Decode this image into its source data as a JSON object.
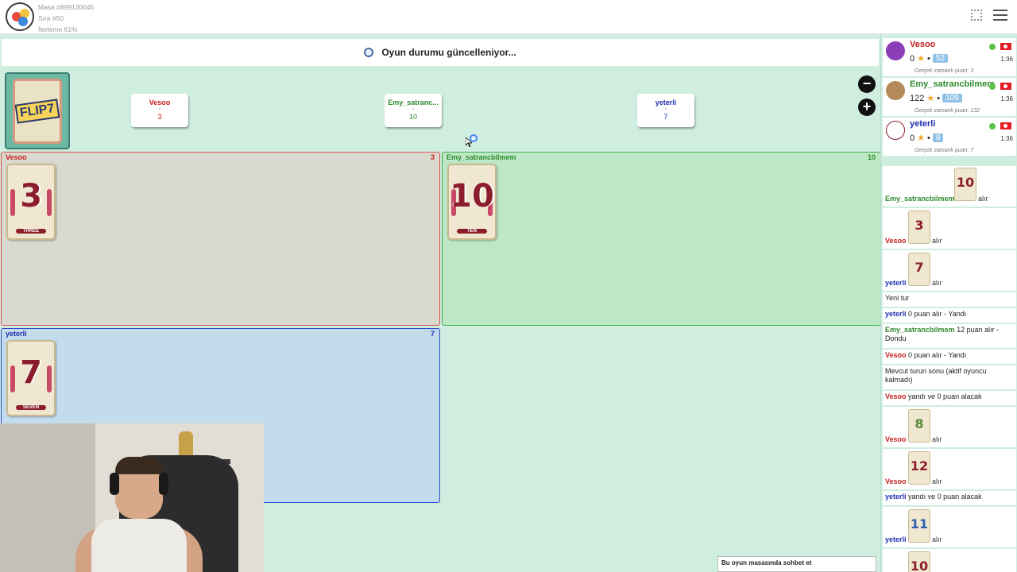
{
  "header": {
    "table": "Masa #899130045",
    "turn": "Sıra #50",
    "progress": "İlerleme 61%"
  },
  "status": {
    "message": "Oyun durumu güncelleniyor..."
  },
  "deck": {
    "label": "FLIP7",
    "left_letter": "Fl"
  },
  "score_tabs": [
    {
      "name": "Vesoo",
      "dash": "-",
      "score": "3",
      "color": "#c81e1e"
    },
    {
      "name": "Emy_satranc...",
      "dash": "-",
      "score": "10",
      "color": "#2e8b2e"
    },
    {
      "name": "yeterli",
      "dash": "-",
      "score": "7",
      "color": "#1f2fb0"
    }
  ],
  "panels": [
    {
      "name": "Vesoo",
      "score": "3",
      "card": {
        "num": "3",
        "word": "THREE"
      }
    },
    {
      "name": "Emy_satrancbilmem",
      "score": "10",
      "card": {
        "num": "10",
        "word": "TEN"
      }
    },
    {
      "name": "yeterli",
      "score": "7",
      "card": {
        "num": "7",
        "word": "SEVEN"
      }
    }
  ],
  "zoom": {
    "out": "−",
    "in": "+"
  },
  "players": [
    {
      "name": "Vesoo",
      "points": "0",
      "elo": "52",
      "realtime": "Gerçek zamanlı puan: 3",
      "time": "1:36",
      "color": "#c81e1e",
      "avatar": "#8a3fb8"
    },
    {
      "name": "Emy_satrancbilmem",
      "points": "122",
      "elo": "109",
      "realtime": "Gerçek zamanlı puan: 132",
      "time": "1:36",
      "color": "#2e8b2e",
      "avatar": "#b58a5a"
    },
    {
      "name": "yeterli",
      "points": "0",
      "elo": "8",
      "realtime": "Gerçek zamanlı puan: 7",
      "time": "1:36",
      "color": "#1f2fb0",
      "avatar": "#e9e2d6"
    }
  ],
  "log": {
    "verb_takes": "alır",
    "entries": [
      {
        "player": "Emy_satrancbilmem",
        "card": "10"
      },
      {
        "player": "Vesoo",
        "card": "3"
      },
      {
        "player": "yeterli",
        "card": "7"
      }
    ],
    "new_round": "Yeni tur",
    "line_yeterli": {
      "player": "yeterli",
      "text": "0 puan alır - Yandı"
    },
    "line_emy": {
      "player": "Emy_satrancbilmem",
      "text": "12 puan alır - Dondu"
    },
    "line_vesoo": {
      "player": "Vesoo",
      "text": "0 puan alır - Yandı"
    },
    "round_end": "Mevcut turun sonu (aktif oyuncu kalmadı)",
    "vesoo_burned": {
      "player": "Vesoo",
      "text": "yandı ve 0 puan alacak"
    },
    "entries2": [
      {
        "player": "Vesoo",
        "card": "8"
      },
      {
        "player": "Vesoo",
        "card": "12"
      }
    ],
    "yeterli_burned": {
      "player": "yeterli",
      "text": "yandı ve 0 puan alacak"
    },
    "entries3": [
      {
        "player": "yeterli",
        "card": "11"
      }
    ],
    "last_card": "10"
  },
  "chat": {
    "placeholder": "Bu oyun masasında sohbet et"
  }
}
